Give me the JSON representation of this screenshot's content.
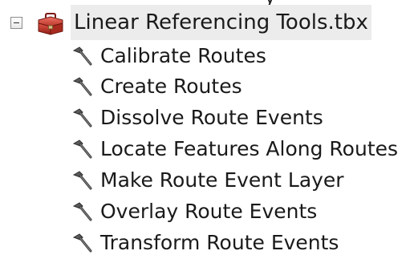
{
  "toolbox": {
    "name": "Linear Referencing Tools.tbx",
    "icon": "toolbox-icon",
    "expanded": true,
    "tools": [
      {
        "label": "Calibrate Routes",
        "icon": "hammer-icon"
      },
      {
        "label": "Create Routes",
        "icon": "hammer-icon"
      },
      {
        "label": "Dissolve Route Events",
        "icon": "hammer-icon"
      },
      {
        "label": "Locate Features Along Routes",
        "icon": "hammer-icon"
      },
      {
        "label": "Make Route Event Layer",
        "icon": "hammer-icon"
      },
      {
        "label": "Overlay Route Events",
        "icon": "hammer-icon"
      },
      {
        "label": "Transform Route Events",
        "icon": "hammer-icon"
      }
    ]
  },
  "colors": {
    "selection_bg": "#ececec",
    "toolbox_red": "#c0392b"
  }
}
